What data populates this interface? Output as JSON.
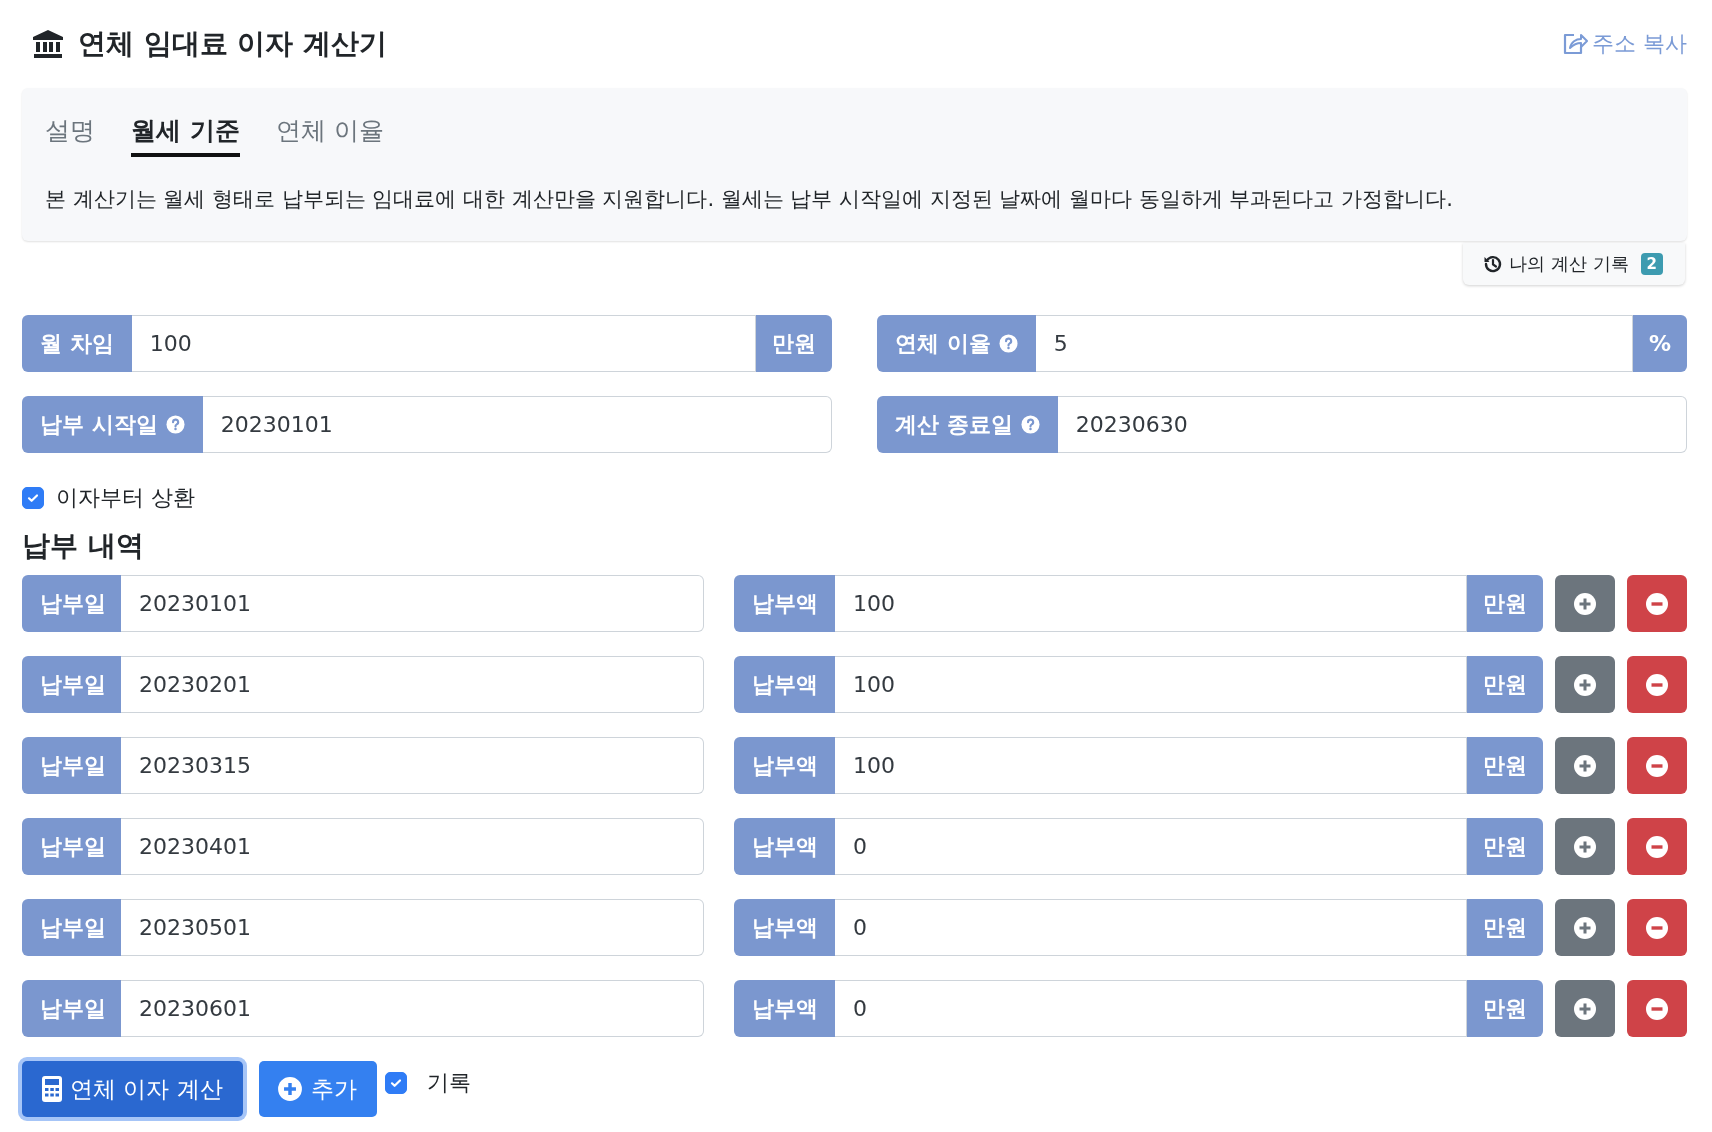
{
  "header": {
    "title": "연체 임대료 이자 계산기",
    "share_link": "주소 복사"
  },
  "tabs": [
    {
      "label": "설명",
      "selected": false
    },
    {
      "label": "월세 기준",
      "selected": true
    },
    {
      "label": "연체 이율",
      "selected": false
    }
  ],
  "description": "본 계산기는 월세 형태로 납부되는 임대료에 대한 계산만을 지원합니다. 월세는 납부 시작일에 지정된 날짜에 월마다 동일하게 부과된다고 가정합니다.",
  "history_button": {
    "label": "나의 계산 기록",
    "count": "2"
  },
  "fields": [
    {
      "label": "월 차임",
      "help": false,
      "value": "100",
      "suffix": "만원"
    },
    {
      "label": "연체 이율",
      "help": true,
      "value": "5",
      "suffix": "%"
    },
    {
      "label": "납부 시작일",
      "help": true,
      "value": "20230101"
    },
    {
      "label": "계산 종료일",
      "help": true,
      "value": "20230630"
    }
  ],
  "interest_first": {
    "label": "이자부터 상환",
    "checked": true
  },
  "payments_heading": "납부 내역",
  "payments": [
    {
      "date_label": "납부일",
      "date": "20230101",
      "amount_label": "납부액",
      "amount": "100",
      "unit": "만원"
    },
    {
      "date_label": "납부일",
      "date": "20230201",
      "amount_label": "납부액",
      "amount": "100",
      "unit": "만원"
    },
    {
      "date_label": "납부일",
      "date": "20230315",
      "amount_label": "납부액",
      "amount": "100",
      "unit": "만원"
    },
    {
      "date_label": "납부일",
      "date": "20230401",
      "amount_label": "납부액",
      "amount": "0",
      "unit": "만원"
    },
    {
      "date_label": "납부일",
      "date": "20230501",
      "amount_label": "납부액",
      "amount": "0",
      "unit": "만원"
    },
    {
      "date_label": "납부일",
      "date": "20230601",
      "amount_label": "납부액",
      "amount": "0",
      "unit": "만원"
    }
  ],
  "actions": {
    "calculate": "연체 이자 계산",
    "add": "추가",
    "record": {
      "label": "기록",
      "checked": true
    }
  }
}
